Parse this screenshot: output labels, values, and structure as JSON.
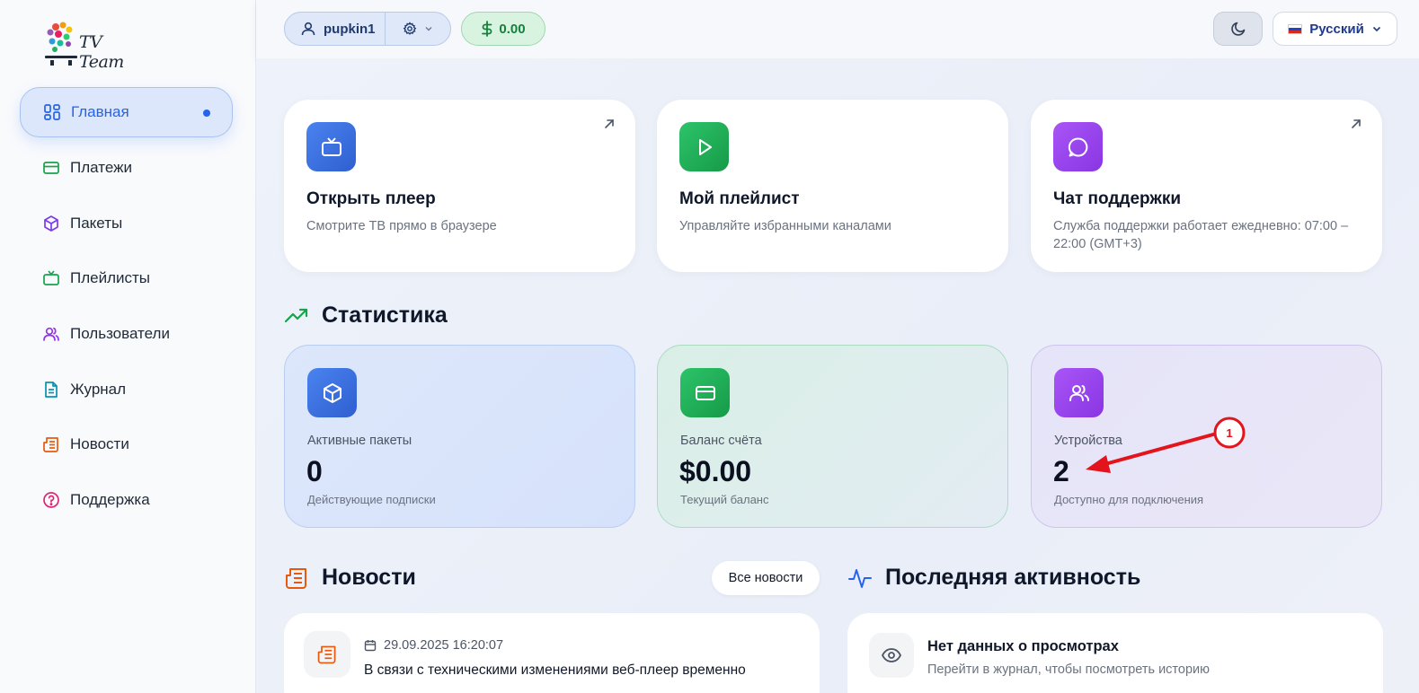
{
  "brand": {
    "logo_text": "TV Team"
  },
  "sidebar": {
    "items": [
      {
        "label": "Главная",
        "icon": "dashboard-grid-icon",
        "active": true
      },
      {
        "label": "Платежи",
        "icon": "credit-card-icon"
      },
      {
        "label": "Пакеты",
        "icon": "package-box-icon"
      },
      {
        "label": "Плейлисты",
        "icon": "tv-icon"
      },
      {
        "label": "Пользователи",
        "icon": "users-icon"
      },
      {
        "label": "Журнал",
        "icon": "document-icon"
      },
      {
        "label": "Новости",
        "icon": "newspaper-icon"
      },
      {
        "label": "Поддержка",
        "icon": "help-circle-icon"
      }
    ]
  },
  "header": {
    "username": "pupkin1",
    "balance": "0.00",
    "language": "Русский"
  },
  "quick_cards": [
    {
      "title": "Открыть плеер",
      "desc": "Смотрите ТВ прямо в браузере",
      "icon": "tv-icon",
      "color": "#3b6fe0",
      "external": true
    },
    {
      "title": "Мой плейлист",
      "desc": "Управляйте избранными каналами",
      "icon": "play-icon",
      "color": "#22b35a",
      "external": false
    },
    {
      "title": "Чат поддержки",
      "desc": "Служба поддержки работает ежедневно: 07:00 – 22:00 (GMT+3)",
      "icon": "chat-bubble-icon",
      "color": "#9a45ec",
      "external": true
    }
  ],
  "stats": {
    "title": "Статистика",
    "cards": [
      {
        "label": "Активные пакеты",
        "value": "0",
        "sub": "Действующие подписки",
        "icon": "package-box-icon",
        "color": "#3b6fe0"
      },
      {
        "label": "Баланс счёта",
        "value": "$0.00",
        "sub": "Текущий баланс",
        "icon": "credit-card-icon",
        "color": "#22b35a"
      },
      {
        "label": "Устройства",
        "value": "2",
        "sub": "Доступно для подключения",
        "icon": "users-icon",
        "color": "#9a45ec"
      }
    ]
  },
  "news": {
    "title": "Новости",
    "all_label": "Все новости",
    "items": [
      {
        "date": "29.09.2025 16:20:07",
        "text": "В связи с техническими изменениями веб-плеер временно"
      }
    ]
  },
  "activity": {
    "title": "Последняя активность",
    "empty_title": "Нет данных о просмотрах",
    "empty_sub": "Перейти в журнал, чтобы посмотреть историю"
  },
  "annotation": {
    "label": "1",
    "color": "#e3141b"
  }
}
